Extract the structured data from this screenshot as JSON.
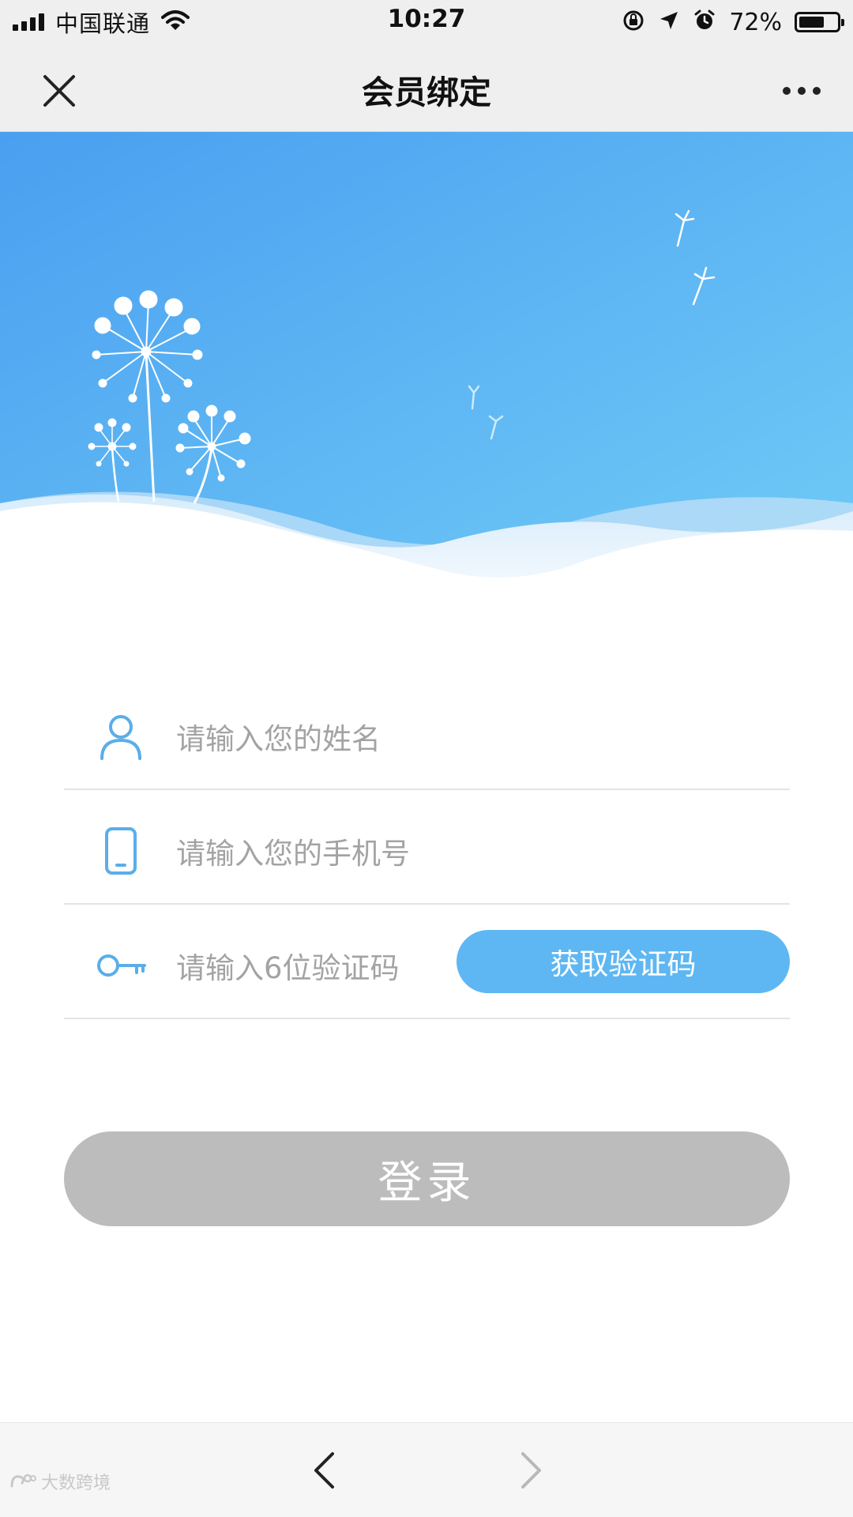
{
  "status_bar": {
    "carrier": "中国联通",
    "time": "10:27",
    "battery": "72%",
    "battery_level": 0.72
  },
  "nav": {
    "title": "会员绑定",
    "close_icon": "close-icon",
    "more_icon": "more-icon"
  },
  "form": {
    "name_placeholder": "请输入您的姓名",
    "phone_placeholder": "请输入您的手机号",
    "code_placeholder": "请输入6位验证码",
    "get_code_label": "获取验证码"
  },
  "login_label": "登录",
  "bottom_bar": {
    "back_icon": "chevron-left-icon",
    "forward_icon": "chevron-right-icon"
  },
  "watermark": "大数跨境",
  "colors": {
    "accent": "#5eb7f2",
    "icon": "#5aaee8",
    "login_disabled": "#bcbcbc",
    "banner_top": "#4ea6f1",
    "banner_bottom": "#6dc8f5"
  }
}
